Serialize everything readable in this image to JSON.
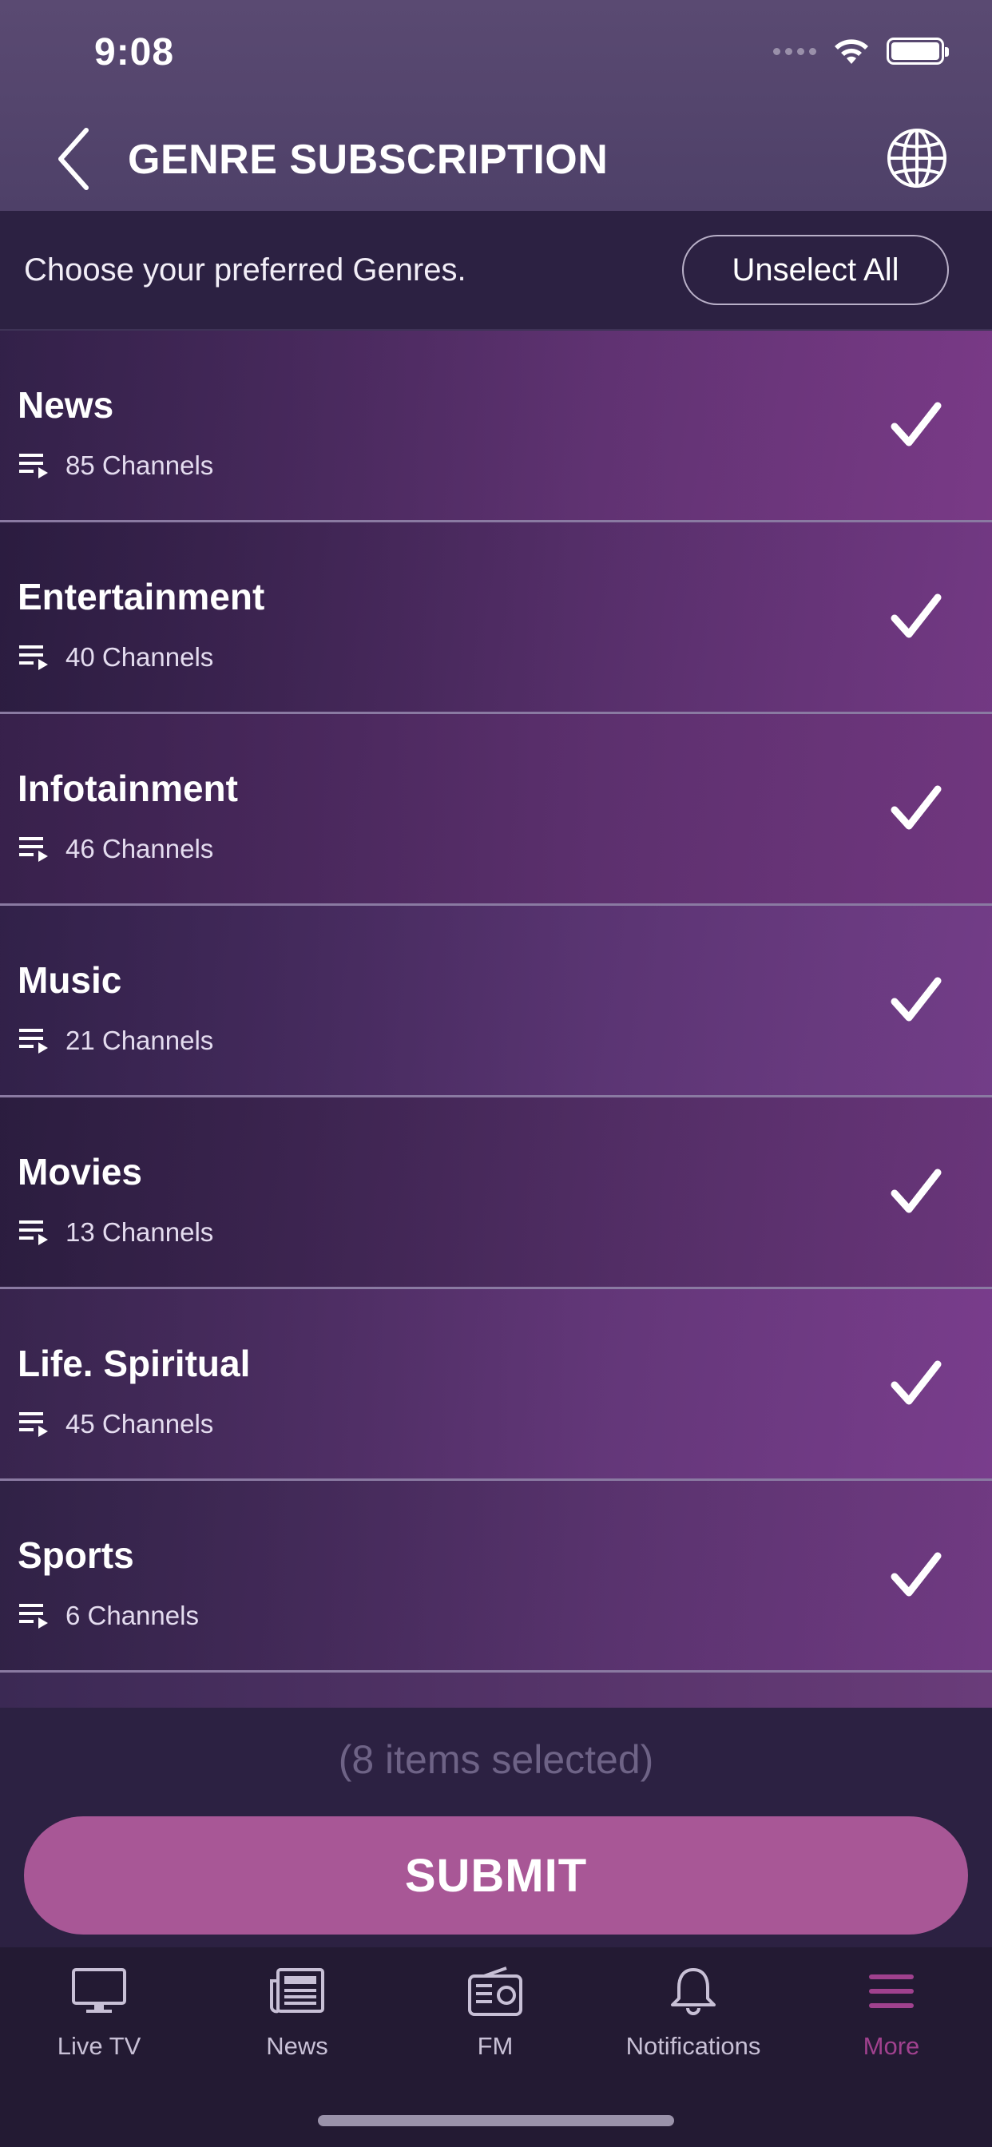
{
  "status_bar": {
    "time": "9:08"
  },
  "header": {
    "title": "GENRE SUBSCRIPTION"
  },
  "subheader": {
    "prompt": "Choose your preferred Genres.",
    "unselect_all_label": "Unselect All"
  },
  "genres": [
    {
      "name": "News",
      "count": "85 Channels",
      "selected": true,
      "bg": "#3f2a58",
      "bg2": "#7a3c86"
    },
    {
      "name": "Entertainment",
      "count": "40 Channels",
      "selected": true,
      "bg": "#2e2044",
      "bg2": "#6e3a80"
    },
    {
      "name": "Infotainment",
      "count": "46 Channels",
      "selected": true,
      "bg": "#4a2a5e",
      "bg2": "#6a3678"
    },
    {
      "name": "Music",
      "count": "21 Channels",
      "selected": true,
      "bg": "#3c2a58",
      "bg2": "#6e4288"
    },
    {
      "name": "Movies",
      "count": "13 Channels",
      "selected": true,
      "bg": "#2e2142",
      "bg2": "#5e3470"
    },
    {
      "name": "Life. Spiritual",
      "count": "45 Channels",
      "selected": true,
      "bg": "#4a3262",
      "bg2": "#7a4290"
    },
    {
      "name": "Sports",
      "count": "6 Channels",
      "selected": true,
      "bg": "#3a2c52",
      "bg2": "#6a3c7e"
    }
  ],
  "footer": {
    "selected_text": "(8 items selected)",
    "submit_label": "SUBMIT"
  },
  "tabs": [
    {
      "label": "Live TV",
      "icon": "tv-icon",
      "active": false
    },
    {
      "label": "News",
      "icon": "newspaper-icon",
      "active": false
    },
    {
      "label": "FM",
      "icon": "radio-icon",
      "active": false
    },
    {
      "label": "Notifications",
      "icon": "bell-icon",
      "active": false
    },
    {
      "label": "More",
      "icon": "menu-icon",
      "active": true
    }
  ],
  "colors": {
    "accent": "#a85796",
    "active_tab": "#a0418e",
    "header_bg": "#5a4a72",
    "background": "#2c2142"
  }
}
